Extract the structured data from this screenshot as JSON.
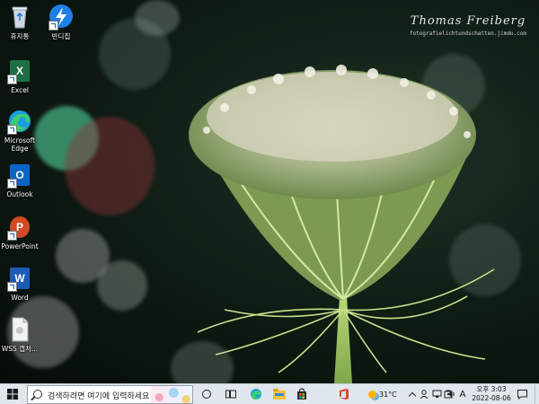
{
  "wallpaper": {
    "watermark_name": "Thomas Freiberg",
    "watermark_url": "fotografielichtundschatten.jimdo.com"
  },
  "desktop_icons": [
    {
      "label": "휴지통",
      "icon": "recycle-bin-icon"
    },
    {
      "label": "반디집",
      "icon": "bandizip-icon"
    },
    {
      "label": "Excel",
      "icon": "excel-icon"
    },
    {
      "label": "Microsoft Edge",
      "icon": "edge-icon"
    },
    {
      "label": "Outlook",
      "icon": "outlook-icon"
    },
    {
      "label": "PowerPoint",
      "icon": "powerpoint-icon"
    },
    {
      "label": "Word",
      "icon": "word-icon"
    },
    {
      "label": "WSS 캡처...",
      "icon": "file-icon"
    }
  ],
  "taskbar": {
    "search_placeholder": "검색하려면 여기에 입력하세요",
    "pinned": [
      "cortana-icon",
      "task-view-icon",
      "edge-icon",
      "file-explorer-icon",
      "store-icon",
      "office-icon"
    ],
    "weather": "31°C",
    "ime": "A",
    "time": "오후 3:03",
    "date": "2022-08-06"
  },
  "colors": {
    "taskbar_bg": "#dfe6ec",
    "excel": "#1d7044",
    "outlook": "#0a64c8",
    "powerpoint": "#d14a23",
    "word": "#1e5bb8"
  }
}
